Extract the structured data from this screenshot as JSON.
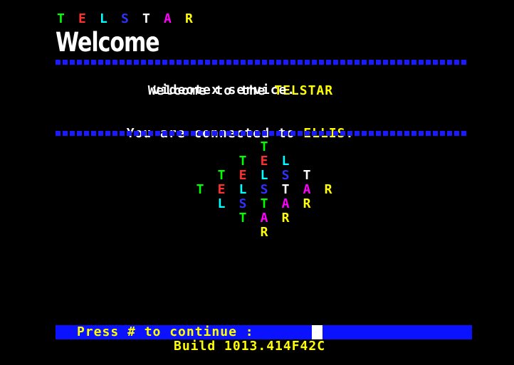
{
  "header": {
    "logo_letters": [
      {
        "char": "T",
        "color": "#00ff00"
      },
      {
        "char": "E",
        "color": "#ff3030"
      },
      {
        "char": "L",
        "color": "#00ffff"
      },
      {
        "char": "S",
        "color": "#3030ff"
      },
      {
        "char": "T",
        "color": "#ffffff"
      },
      {
        "char": "A",
        "color": "#ff00ff"
      },
      {
        "char": "R",
        "color": "#ffff00"
      }
    ],
    "page_title": "Welcome"
  },
  "message": {
    "line1_prefix": "Welcome to the ",
    "line1_highlight": "TELSTAR",
    "line2": "videotex service.",
    "line3_prefix": "You are connected to ",
    "line3_highlight": "ELLIS."
  },
  "diamond": [
    [
      "T"
    ],
    [
      "T",
      "E",
      "L"
    ],
    [
      "T",
      "E",
      "L",
      "S",
      "T"
    ],
    [
      "T",
      "E",
      "L",
      "S",
      "T",
      "A",
      "R"
    ],
    [
      "L",
      "S",
      "T",
      "A",
      "R"
    ],
    [
      "T",
      "A",
      "R"
    ],
    [
      "R"
    ]
  ],
  "colors": {
    "T": "#00ff00",
    "E": "#ff3030",
    "L": "#00ffff",
    "S": "#3030ff",
    "A": "#ff00ff",
    "R": "#ffff00",
    "T_white": "#ffffff",
    "text_white": "#ffffff",
    "text_yellow": "#ffff00",
    "bar_blue": "#0a12ff"
  },
  "footer": {
    "prompt": "Press # to continue :",
    "build": "Build 1013.414F42C"
  }
}
